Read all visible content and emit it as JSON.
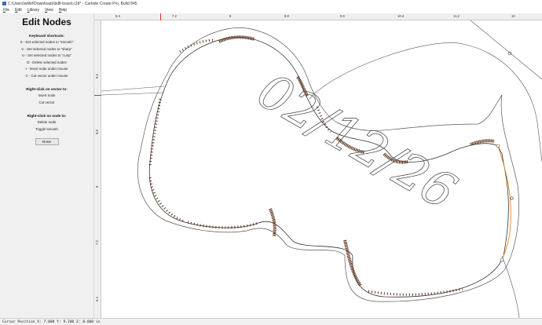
{
  "window": {
    "title": "C:\\Users\\willof\\Downloads\\bdfl-board.c2d* - Carbide Create Pro, Build 845"
  },
  "menu": {
    "file": "File",
    "edit": "Edit",
    "library": "Library",
    "view": "View",
    "help": "Help"
  },
  "sidebar": {
    "title": "Edit Nodes",
    "keyboard_title": "Keyboard shortcuts:",
    "shortcuts": [
      "S - Set selected nodes to \"smooth\"",
      "V - Set selected nodes to \"sharp\"",
      "U - Set selected nodes to \"cusp\"",
      "D - Delete selected nodes",
      "I - Insert node under mouse",
      "C - Cut vector under mouse"
    ],
    "vector_title": "Right-click on vector to:",
    "vector_actions": [
      "Insert node",
      "Cut vector"
    ],
    "node_title": "Right-click on node to:",
    "node_actions": [
      "Delete node",
      "Toggle smooth"
    ],
    "done_label": "Done"
  },
  "ruler": {
    "top_labels": [
      "6.4",
      "7.2",
      "8",
      "8.8",
      "9.6",
      "10.4",
      "11.2",
      "12"
    ],
    "left_labels": [
      "9.6",
      "8.8",
      "8",
      "7.2",
      "6.4"
    ]
  },
  "canvas": {
    "engraved_text": "02/12/26"
  },
  "status": {
    "cursor_position": "Cursor Position X: 7.000 Y: 9.200 Z: 0.000 in"
  },
  "colors": {
    "sidebar_bg": "#f0f0f0",
    "node_color": "#5a2e1a",
    "selected_segment": "#e8822a",
    "vector_line": "#333333",
    "ruler_marker": "#e0302a"
  },
  "icons": {
    "app_icon": "carbide-create-icon"
  }
}
